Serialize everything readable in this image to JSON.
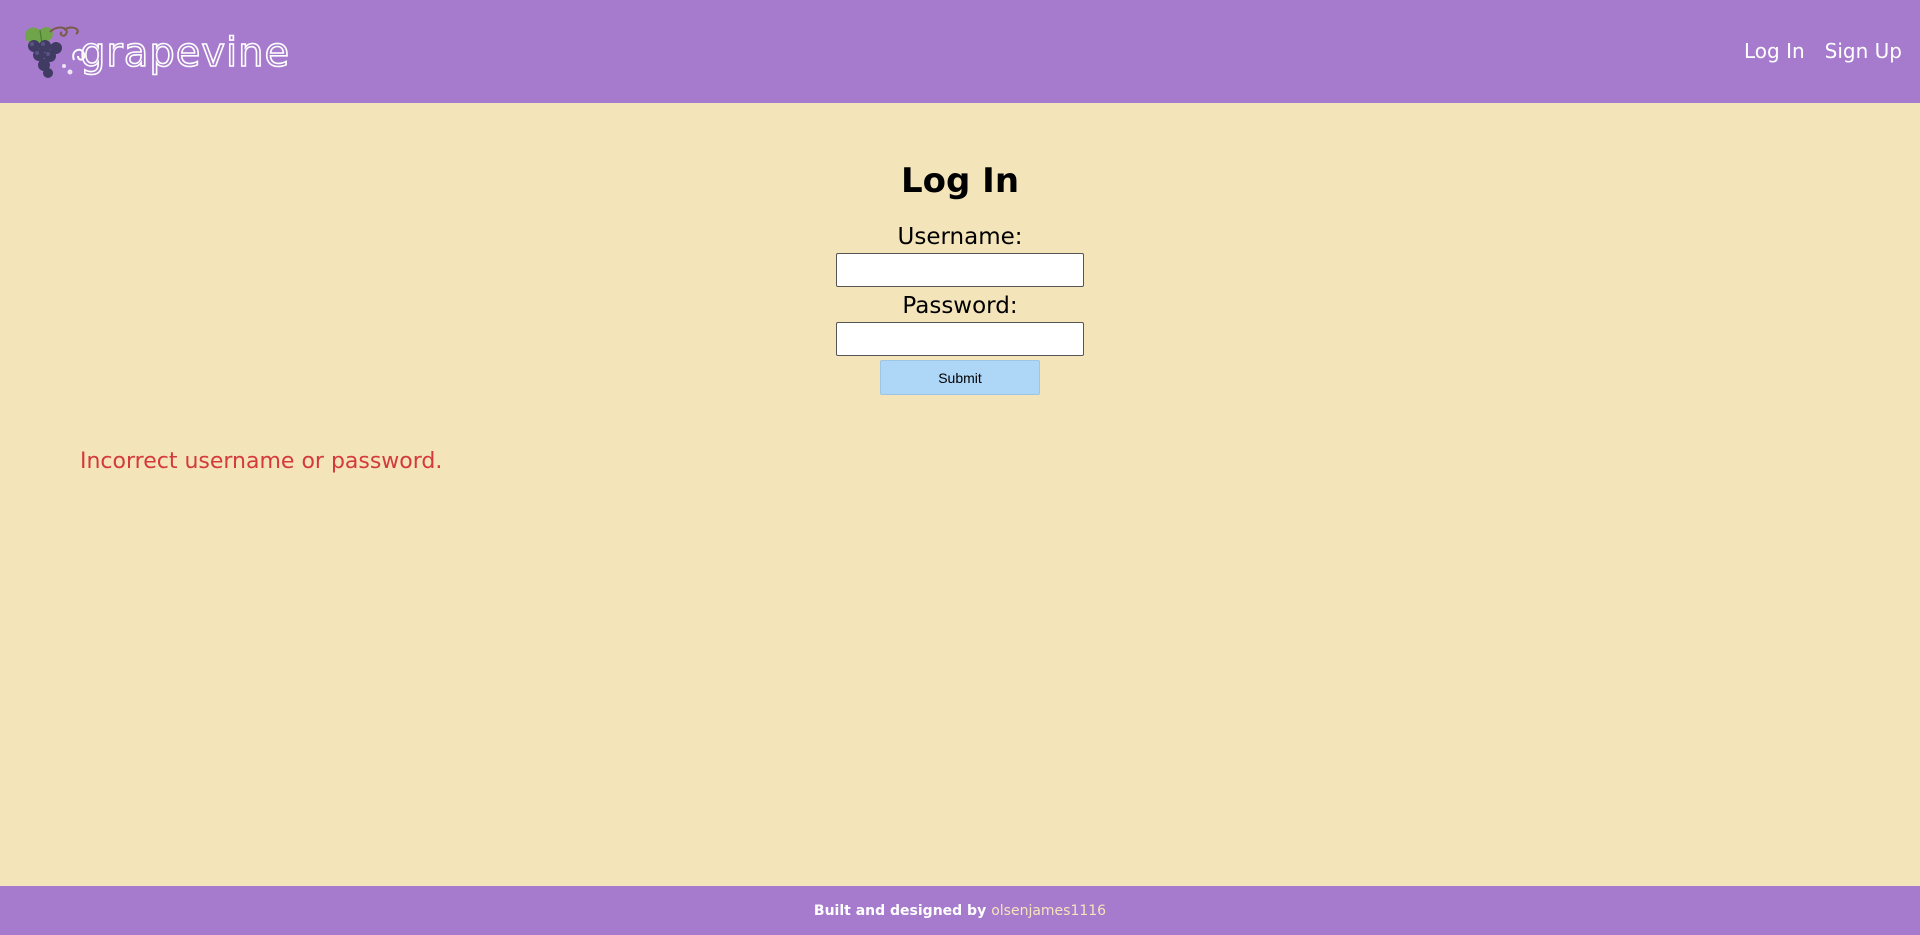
{
  "header": {
    "logo_text": "grapevine",
    "nav": {
      "login_label": "Log In",
      "signup_label": "Sign Up"
    }
  },
  "form": {
    "title": "Log In",
    "username_label": "Username:",
    "username_value": "",
    "password_label": "Password:",
    "password_value": "",
    "submit_label": "Submit"
  },
  "error_message": "Incorrect username or password.",
  "footer": {
    "credit_text": "Built and designed by",
    "credit_link": "olsenjames1116"
  },
  "colors": {
    "header_bg": "#A67BCD",
    "page_bg": "#F4E4BA",
    "submit_bg": "#ADD6F7",
    "error": "#D33A3F"
  }
}
